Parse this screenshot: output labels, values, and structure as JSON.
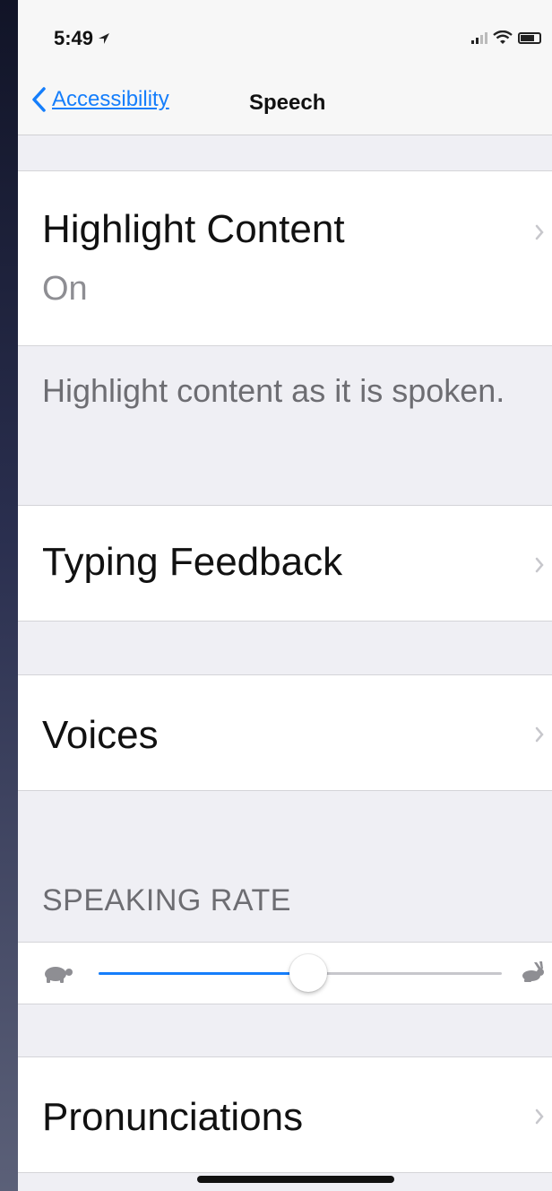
{
  "status_bar": {
    "time": "5:49"
  },
  "nav": {
    "back_label": "Accessibility",
    "title": "Speech"
  },
  "cells": {
    "highlight_content": {
      "title": "Highlight Content",
      "value": "On"
    },
    "highlight_footer": "Highlight content as it is spoken.",
    "typing_feedback": {
      "title": "Typing Feedback"
    },
    "voices": {
      "title": "Voices"
    },
    "pronunciations": {
      "title": "Pronunciations"
    }
  },
  "speaking_rate": {
    "header": "SPEAKING RATE",
    "value_fraction": 0.52
  },
  "colors": {
    "accent": "#157efb",
    "background": "#efeff4",
    "cell": "#ffffff",
    "secondary_text": "#8e8e93"
  },
  "icons": [
    "location-arrow-icon",
    "signal-icon",
    "wifi-icon",
    "battery-icon",
    "back-chevron-icon",
    "chevron-right-icon",
    "turtle-icon",
    "hare-icon"
  ]
}
